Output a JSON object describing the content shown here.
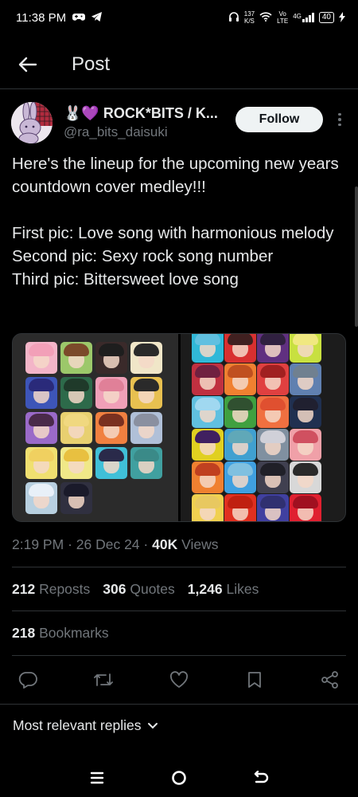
{
  "status_bar": {
    "time": "11:38 PM",
    "net_speed_value": "137",
    "net_speed_unit": "K/S",
    "volte_top": "Vo",
    "volte_bottom": "LTE",
    "network": "4G",
    "battery": "40"
  },
  "header": {
    "title": "Post"
  },
  "author": {
    "display_name": "🐰💜 ROCK*BITS / K...",
    "handle": "@ra_bits_daisuki",
    "follow_label": "Follow"
  },
  "tweet": {
    "line1": "Here's the lineup for the upcoming new years countdown cover medley!!!",
    "line2": "First pic: Love song with harmonious melody",
    "line3": "Second pic: Sexy rock song number",
    "line4": "Third pic: Bittersweet love song"
  },
  "meta": {
    "time": "2:19 PM",
    "sep1": "·",
    "date": "26 Dec 24",
    "sep2": "·",
    "views_count": "40K",
    "views_label": "Views"
  },
  "stats": {
    "reposts_count": "212",
    "reposts_label": "Reposts",
    "quotes_count": "306",
    "quotes_label": "Quotes",
    "likes_count": "1,246",
    "likes_label": "Likes",
    "bookmarks_count": "218",
    "bookmarks_label": "Bookmarks"
  },
  "actions": [
    "reply-icon",
    "repost-icon",
    "like-icon",
    "bookmark-icon",
    "share-icon"
  ],
  "replies": {
    "sort_label": "Most relevant replies"
  },
  "colors": {
    "background": "#000000",
    "text_primary": "#e7e9ea",
    "text_secondary": "#71767b",
    "divider": "#2f3336",
    "follow_bg": "#eff3f4"
  }
}
